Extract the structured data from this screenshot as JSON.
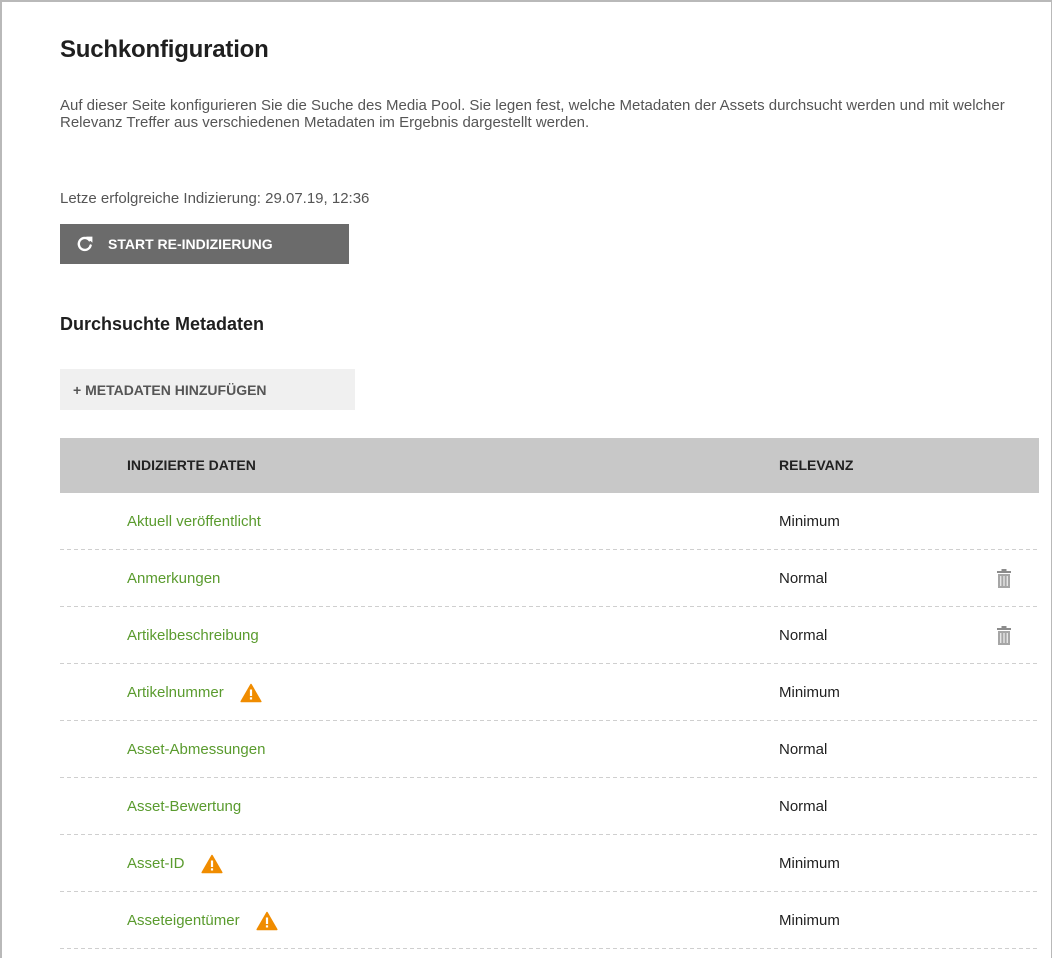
{
  "page": {
    "title": "Suchkonfiguration",
    "intro": "Auf dieser Seite konfigurieren Sie die Suche des Media Pool. Sie legen fest, welche Metadaten der Assets durchsucht werden und mit welcher Relevanz Treffer aus verschiedenen Metadaten im Ergebnis dargestellt werden.",
    "last_index": "Letze erfolgreiche Indizierung: 29.07.19, 12:36",
    "reindex_label": "START RE-INDIZIERUNG"
  },
  "metadata_section": {
    "title": "Durchsuchte Metadaten",
    "add_label": "+ METADATEN HINZUFÜGEN"
  },
  "table": {
    "headers": {
      "data": "INDIZIERTE DATEN",
      "relevance": "RELEVANZ"
    },
    "rows": [
      {
        "name": "Aktuell veröffentlicht",
        "relevance": "Minimum",
        "warning": false,
        "deletable": false
      },
      {
        "name": "Anmerkungen",
        "relevance": "Normal",
        "warning": false,
        "deletable": true
      },
      {
        "name": "Artikelbeschreibung",
        "relevance": "Normal",
        "warning": false,
        "deletable": true
      },
      {
        "name": "Artikelnummer",
        "relevance": "Minimum",
        "warning": true,
        "deletable": false
      },
      {
        "name": "Asset-Abmessungen",
        "relevance": "Normal",
        "warning": false,
        "deletable": false
      },
      {
        "name": "Asset-Bewertung",
        "relevance": "Normal",
        "warning": false,
        "deletable": false
      },
      {
        "name": "Asset-ID",
        "relevance": "Minimum",
        "warning": true,
        "deletable": false
      },
      {
        "name": "Asseteigentümer",
        "relevance": "Minimum",
        "warning": true,
        "deletable": false
      }
    ]
  },
  "icons": {
    "reindex": "refresh-icon",
    "warning": "warning-triangle-icon",
    "delete": "trash-icon"
  },
  "colors": {
    "link_green": "#5a9b2e",
    "warning_orange": "#f08c00",
    "button_dark": "#6b6b6b",
    "header_gray": "#c8c8c8"
  }
}
